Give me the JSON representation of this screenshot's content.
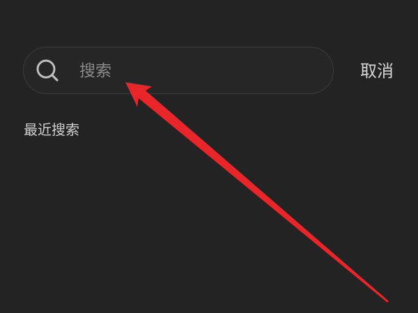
{
  "search": {
    "placeholder": "搜索",
    "value": ""
  },
  "header": {
    "cancel_label": "取消"
  },
  "recent": {
    "title": "最近搜索"
  },
  "icons": {
    "search": "search-icon"
  },
  "colors": {
    "background": "#232323",
    "arrow": "#e8262a"
  }
}
